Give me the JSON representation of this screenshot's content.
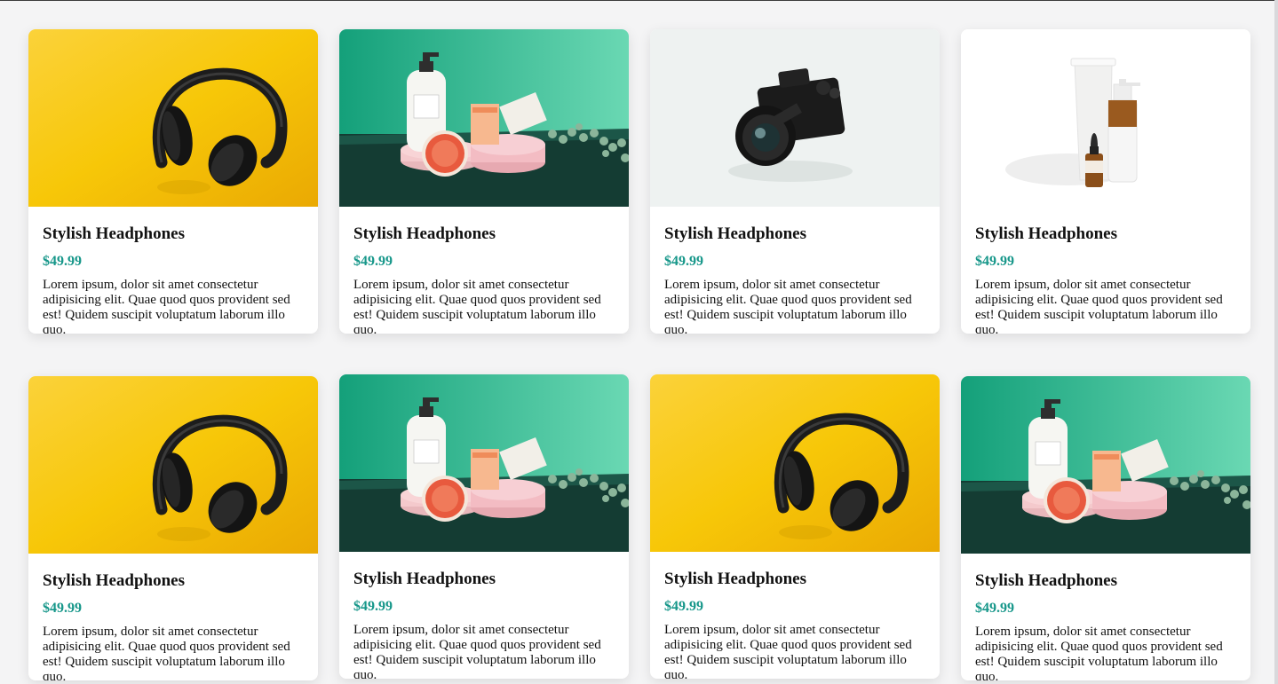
{
  "products": [
    {
      "image": "headphones-image",
      "title": "Stylish Headphones",
      "price": "$49.99",
      "description": "Lorem ipsum, dolor sit amet consectetur adipisicing elit. Quae quod quos provident sed est! Quidem suscipit voluptatum laborum illo quo."
    },
    {
      "image": "skincare-set-image",
      "title": "Stylish Headphones",
      "price": "$49.99",
      "description": "Lorem ipsum, dolor sit amet consectetur adipisicing elit. Quae quod quos provident sed est! Quidem suscipit voluptatum laborum illo quo."
    },
    {
      "image": "camera-image",
      "title": "Stylish Headphones",
      "price": "$49.99",
      "description": "Lorem ipsum, dolor sit amet consectetur adipisicing elit. Quae quod quos provident sed est! Quidem suscipit voluptatum laborum illo quo."
    },
    {
      "image": "serum-bottles-image",
      "title": "Stylish Headphones",
      "price": "$49.99",
      "description": "Lorem ipsum, dolor sit amet consectetur adipisicing elit. Quae quod quos provident sed est! Quidem suscipit voluptatum laborum illo quo."
    },
    {
      "image": "headphones-image",
      "title": "Stylish Headphones",
      "price": "$49.99",
      "description": "Lorem ipsum, dolor sit amet consectetur adipisicing elit. Quae quod quos provident sed est! Quidem suscipit voluptatum laborum illo quo."
    },
    {
      "image": "skincare-set-image",
      "title": "Stylish Headphones",
      "price": "$49.99",
      "description": "Lorem ipsum, dolor sit amet consectetur adipisicing elit. Quae quod quos provident sed est! Quidem suscipit voluptatum laborum illo quo."
    },
    {
      "image": "headphones-image",
      "title": "Stylish Headphones",
      "price": "$49.99",
      "description": "Lorem ipsum, dolor sit amet consectetur adipisicing elit. Quae quod quos provident sed est! Quidem suscipit voluptatum laborum illo quo."
    },
    {
      "image": "skincare-set-image",
      "title": "Stylish Headphones",
      "price": "$49.99",
      "description": "Lorem ipsum, dolor sit amet consectetur adipisicing elit. Quae quod quos provident sed est! Quidem suscipit voluptatum laborum illo quo."
    }
  ],
  "colors": {
    "price": "#17978a",
    "background": "#f4f4f5",
    "card": "#ffffff"
  }
}
